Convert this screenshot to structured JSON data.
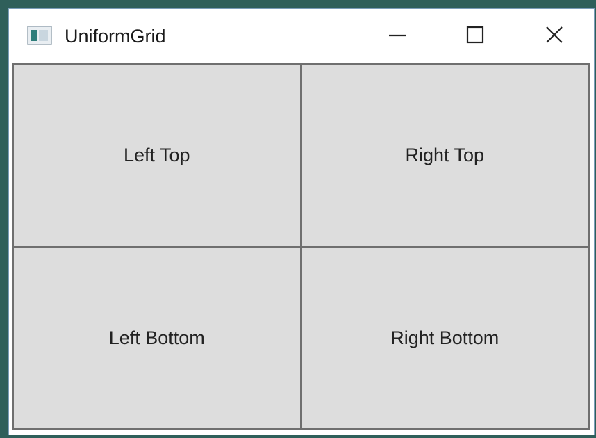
{
  "window": {
    "title": "UniformGrid",
    "icons": {
      "app": "window-app-icon",
      "minimize": "minimize-icon",
      "maximize": "maximize-icon",
      "close": "close-icon"
    }
  },
  "grid": {
    "cells": [
      {
        "label": "Left Top"
      },
      {
        "label": "Right Top"
      },
      {
        "label": "Left Bottom"
      },
      {
        "label": "Right Bottom"
      }
    ]
  },
  "colors": {
    "cell_background": "#dddddd",
    "grid_lines": "#6f6f6f",
    "desktop": "#2f5f5a",
    "window_border": "#7a9cb8"
  }
}
